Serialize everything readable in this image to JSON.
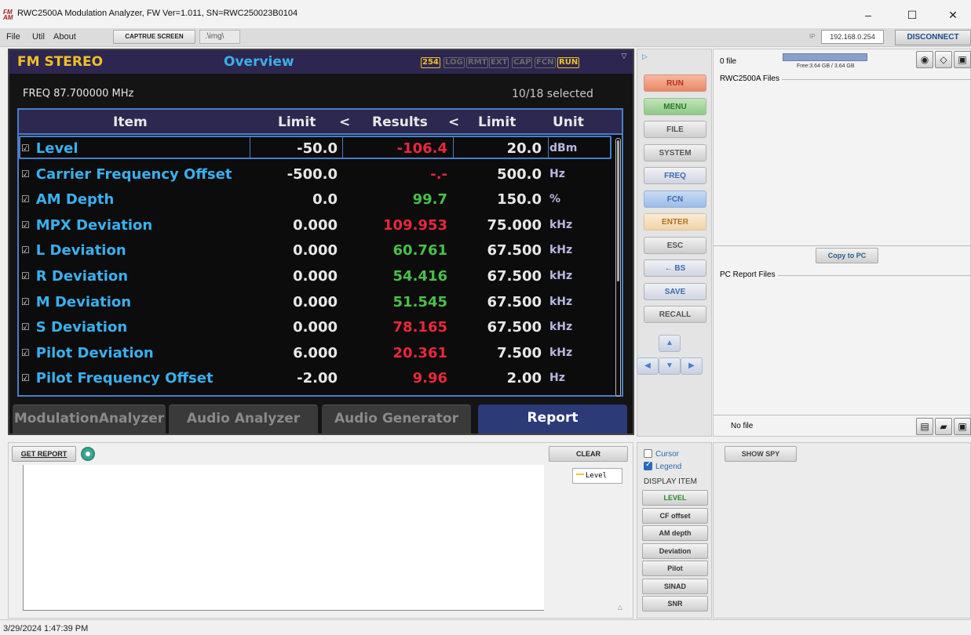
{
  "window": {
    "title": "RWC2500A Modulation Analyzer, FW Ver=1.011, SN=RWC250023B0104",
    "logo_text": "FM AM",
    "minimize": "–",
    "maximize": "☐",
    "close": "✕"
  },
  "menu": {
    "items": [
      "File",
      "Util",
      "About"
    ],
    "capture_label": "CAPTRUE SCREEN",
    "img_path": ".\\img\\",
    "ip_label": "IP",
    "ip_value": "192.168.0.254",
    "disconnect_label": "DISCONNECT"
  },
  "screen": {
    "mode": "FM STEREO",
    "title": "Overview",
    "flags": [
      {
        "label": "254",
        "color": "#f0c028"
      },
      {
        "label": "LOG",
        "color": "#6a6a6a"
      },
      {
        "label": "RMT",
        "color": "#6a6a6a"
      },
      {
        "label": "EXT",
        "color": "#6a6a6a"
      },
      {
        "label": "CAP",
        "color": "#6a6a6a"
      },
      {
        "label": "FCN",
        "color": "#6a6a6a"
      },
      {
        "label": "RUN",
        "color": "#f0c028"
      }
    ],
    "freq": "FREQ 87.700000 MHz",
    "selected": "10/18 selected",
    "headers": {
      "item": "Item",
      "limit_low": "Limit",
      "lt1": "<",
      "results": "Results",
      "lt2": "<",
      "limit_high": "Limit",
      "unit": "Unit"
    },
    "rows": [
      {
        "name": "Level",
        "low": "-50.0",
        "result": "-106.4",
        "result_color": "#e8283c",
        "high": "20.0",
        "unit": "dBm"
      },
      {
        "name": "Carrier Frequency Offset",
        "low": "-500.0",
        "result": "-.-",
        "result_color": "#e8283c",
        "high": "500.0",
        "unit": "Hz"
      },
      {
        "name": "AM Depth",
        "low": "0.0",
        "result": "99.7",
        "result_color": "#48c048",
        "high": "150.0",
        "unit": "%"
      },
      {
        "name": "MPX Deviation",
        "low": "0.000",
        "result": "109.953",
        "result_color": "#e8283c",
        "high": "75.000",
        "unit": "kHz"
      },
      {
        "name": "L Deviation",
        "low": "0.000",
        "result": "60.761",
        "result_color": "#48c048",
        "high": "67.500",
        "unit": "kHz"
      },
      {
        "name": "R Deviation",
        "low": "0.000",
        "result": "54.416",
        "result_color": "#48c048",
        "high": "67.500",
        "unit": "kHz"
      },
      {
        "name": "M Deviation",
        "low": "0.000",
        "result": "51.545",
        "result_color": "#48c048",
        "high": "67.500",
        "unit": "kHz"
      },
      {
        "name": "S Deviation",
        "low": "0.000",
        "result": "78.165",
        "result_color": "#e8283c",
        "high": "67.500",
        "unit": "kHz"
      },
      {
        "name": "Pilot Deviation",
        "low": "6.000",
        "result": "20.361",
        "result_color": "#e8283c",
        "high": "7.500",
        "unit": "kHz"
      },
      {
        "name": "Pilot Frequency Offset",
        "low": "-2.00",
        "result": "9.96",
        "result_color": "#e8283c",
        "high": "2.00",
        "unit": "Hz"
      }
    ],
    "tabs": [
      {
        "label": "ModulationAnalyzer",
        "active": false
      },
      {
        "label": "Audio Analyzer",
        "active": false
      },
      {
        "label": "Audio Generator",
        "active": false
      },
      {
        "label": "Report",
        "active": true
      }
    ]
  },
  "keys": [
    {
      "label": "RUN",
      "style": "run"
    },
    {
      "label": "MENU",
      "style": "menu"
    },
    {
      "label": "FILE",
      "style": "gray"
    },
    {
      "label": "SYSTEM",
      "style": "gray"
    },
    {
      "label": "FREQ",
      "style": "blue"
    },
    {
      "label": "FCN",
      "style": "fcn"
    },
    {
      "label": "ENTER",
      "style": "enter"
    },
    {
      "label": "ESC",
      "style": "gray"
    },
    {
      "label": "← BS",
      "style": "blue"
    },
    {
      "label": "SAVE",
      "style": "blue"
    },
    {
      "label": "RECALL",
      "style": "gray"
    }
  ],
  "files": {
    "count": "0 file",
    "free": "Free:3.64 GB / 3.64 GB",
    "free_fraction": 1.0,
    "rwc_label": "RWC2500A Files",
    "copy_label": "Copy to PC",
    "pc_label": "PC Report Files",
    "no_file": "No file"
  },
  "report": {
    "get_report_label": "GET REPORT",
    "clear_label": "CLEAR",
    "legend_label": "Level",
    "legend_color": "#e8c828"
  },
  "display": {
    "cursor_label": "Cursor",
    "legend_label": "Legend",
    "display_item_label": "DISPLAY ITEM",
    "items": [
      "LEVEL",
      "CF offset",
      "AM depth",
      "Deviation",
      "Pilot",
      "SINAD",
      "SNR"
    ],
    "active_item": "LEVEL"
  },
  "spy": {
    "show_spy_label": "SHOW SPY"
  },
  "status": {
    "timestamp": "3/29/2024 1:47:39 PM"
  }
}
